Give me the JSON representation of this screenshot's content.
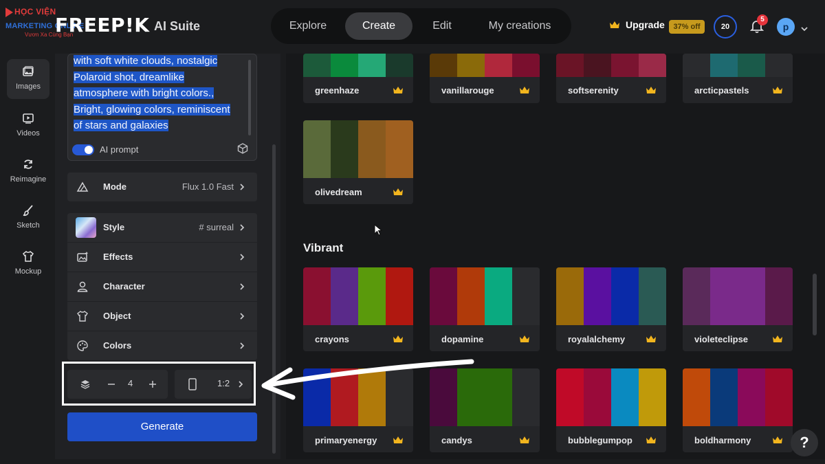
{
  "watermark": {
    "line1": "HỌC VIỆN",
    "line2": "MARKETING ONLINE",
    "line3": "Vươn Xa Cùng Bạn"
  },
  "header": {
    "brand": "FREEP!K",
    "suite": "AI Suite",
    "nav": [
      "Explore",
      "Create",
      "Edit",
      "My creations"
    ],
    "active_nav": "Create",
    "upgrade_label": "Upgrade",
    "discount": "37% off",
    "credits": "20",
    "notifications": "5",
    "avatar_initial": "p"
  },
  "rail": [
    {
      "label": "Images",
      "icon": "image-icon",
      "active": true
    },
    {
      "label": "Videos",
      "icon": "video-icon",
      "active": false
    },
    {
      "label": "Reimagine",
      "icon": "reimagine-icon",
      "active": false
    },
    {
      "label": "Sketch",
      "icon": "brush-icon",
      "active": false
    },
    {
      "label": "Mockup",
      "icon": "shirt-icon",
      "active": false
    }
  ],
  "prompt": {
    "lines": [
      "with soft white clouds, nostalgic",
      "Polaroid shot, dreamlike",
      "atmosphere with bright colors.,",
      "Bright, glowing colors, reminiscent",
      "of stars and galaxies"
    ],
    "ai_prompt_label": "AI prompt",
    "ai_prompt_on": true
  },
  "settings": {
    "mode": {
      "label": "Mode",
      "value": "Flux 1.0 Fast"
    },
    "style": {
      "label": "Style",
      "value": "# surreal"
    },
    "effects": {
      "label": "Effects"
    },
    "character": {
      "label": "Character"
    },
    "object": {
      "label": "Object"
    },
    "colors": {
      "label": "Colors"
    }
  },
  "controls": {
    "count": "4",
    "aspect": "1:2"
  },
  "generate_label": "Generate",
  "section_title": "Vibrant",
  "accent": "#1f4fc7",
  "palettes_top": [
    {
      "name": "greenhaze",
      "colors": [
        "#1c5a3a",
        "#0a8a3c",
        "#25a876",
        "#1a3a2c"
      ]
    },
    {
      "name": "vanillarouge",
      "colors": [
        "#5a3a08",
        "#8a6a0a",
        "#b0283c",
        "#7a0f2e"
      ]
    },
    {
      "name": "softserenity",
      "colors": [
        "#6a1426",
        "#4a1420",
        "#7a1430",
        "#9a2a48"
      ]
    },
    {
      "name": "arcticpastels",
      "colors": [
        "#2a2b2e",
        "#1e6a70",
        "#1a5a4a",
        "#2a2b2e"
      ]
    }
  ],
  "palette_olive": {
    "name": "olivedream",
    "colors": [
      "#5a6a3a",
      "#2a3a1c",
      "#8a5a1e",
      "#a06020"
    ]
  },
  "palettes_vibrant": [
    {
      "name": "crayons",
      "colors": [
        "#8a1030",
        "#5a2a8a",
        "#5a9a0c",
        "#b01810"
      ]
    },
    {
      "name": "dopamine",
      "colors": [
        "#6a0a3c",
        "#b03a0a",
        "#0aaa80",
        "#2a2b2e"
      ]
    },
    {
      "name": "royalalchemy",
      "colors": [
        "#9a6a0a",
        "#5a10a0",
        "#0a2aa8",
        "#2a5a54"
      ]
    },
    {
      "name": "violeteclipse",
      "colors": [
        "#5a2a5a",
        "#7a2a8a",
        "#7a2a8a",
        "#5a1a4a"
      ]
    },
    {
      "name": "primaryenergy",
      "colors": [
        "#0a2aa8",
        "#b01a20",
        "#b07a0a",
        "#2a2b2e"
      ]
    },
    {
      "name": "candys",
      "colors": [
        "#4a0a3c",
        "#2a6a0a",
        "#2a6a0a",
        "#2a2b2e"
      ]
    },
    {
      "name": "bubblegumpop",
      "colors": [
        "#c00a28",
        "#9a0a3a",
        "#0a8ac0",
        "#c09a0a"
      ]
    },
    {
      "name": "boldharmony",
      "colors": [
        "#c04a0a",
        "#0a3a7a",
        "#8a0a5a",
        "#a00a2a"
      ]
    }
  ]
}
